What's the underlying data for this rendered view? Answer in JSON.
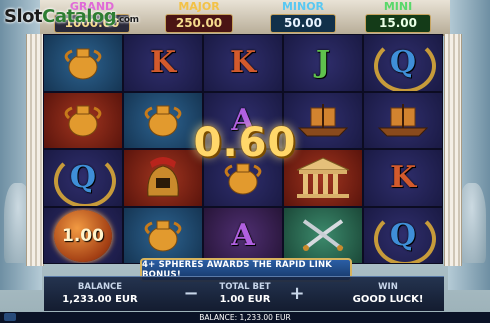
{
  "watermark": {
    "slot": "Slot",
    "catalog": "Catalog",
    "com": ".com"
  },
  "jackpots": {
    "grand": {
      "label": "GRAND",
      "value": "1000.00"
    },
    "major": {
      "label": "MAJOR",
      "value": "250.00"
    },
    "minor": {
      "label": "MINOR",
      "value": "50.00"
    },
    "mini": {
      "label": "MINI",
      "value": "15.00"
    }
  },
  "reels": {
    "row1": [
      "amphora",
      "K",
      "K",
      "J",
      "Q"
    ],
    "row2": [
      "amphora",
      "amphora",
      "A",
      "ship",
      "ship"
    ],
    "row3": [
      "Q",
      "helmet",
      "amphora",
      "temple",
      "K"
    ],
    "row4": [
      "sphere",
      "amphora",
      "A",
      "swords",
      "Q"
    ],
    "sphere_value": "1.00"
  },
  "win_amount": "0.60",
  "banner_text": "4+ SPHERES AWARDS THE RAPID LINK BONUS!",
  "panel": {
    "balance_label": "BALANCE",
    "balance_value": "1,233.00 EUR",
    "totalbet_label": "TOTAL BET",
    "totalbet_value": "1.00 EUR",
    "win_label": "WIN",
    "win_value": "GOOD LUCK!",
    "minus": "−",
    "plus": "+"
  },
  "footer": {
    "text": "BALANCE: 1,233.00 EUR"
  }
}
